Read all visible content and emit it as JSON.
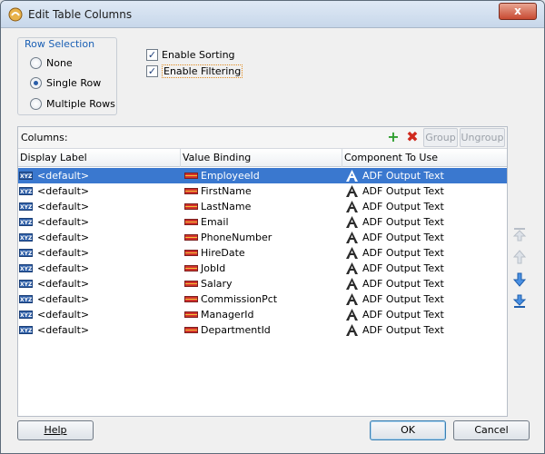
{
  "window": {
    "title": "Edit Table Columns",
    "close_label": "x"
  },
  "row_selection": {
    "legend": "Row Selection",
    "options": [
      {
        "label": "None",
        "checked": false
      },
      {
        "label": "Single Row",
        "checked": true
      },
      {
        "label": "Multiple Rows",
        "checked": false
      }
    ]
  },
  "options": {
    "enable_sorting": {
      "label": "Enable Sorting",
      "checked": true
    },
    "enable_filtering": {
      "label": "Enable Filtering",
      "checked": true
    }
  },
  "columns": {
    "label": "Columns:",
    "toolbar": {
      "add_label": "+",
      "delete_label": "✖",
      "group_label": "Group",
      "ungroup_label": "Ungroup"
    },
    "headers": [
      "Display Label",
      "Value Binding",
      "Component To Use"
    ],
    "rows": [
      {
        "display_label": "<default>",
        "value_binding": "EmployeeId",
        "component": "ADF Output Text",
        "selected": true
      },
      {
        "display_label": "<default>",
        "value_binding": "FirstName",
        "component": "ADF Output Text",
        "selected": false
      },
      {
        "display_label": "<default>",
        "value_binding": "LastName",
        "component": "ADF Output Text",
        "selected": false
      },
      {
        "display_label": "<default>",
        "value_binding": "Email",
        "component": "ADF Output Text",
        "selected": false
      },
      {
        "display_label": "<default>",
        "value_binding": "PhoneNumber",
        "component": "ADF Output Text",
        "selected": false
      },
      {
        "display_label": "<default>",
        "value_binding": "HireDate",
        "component": "ADF Output Text",
        "selected": false
      },
      {
        "display_label": "<default>",
        "value_binding": "JobId",
        "component": "ADF Output Text",
        "selected": false
      },
      {
        "display_label": "<default>",
        "value_binding": "Salary",
        "component": "ADF Output Text",
        "selected": false
      },
      {
        "display_label": "<default>",
        "value_binding": "CommissionPct",
        "component": "ADF Output Text",
        "selected": false
      },
      {
        "display_label": "<default>",
        "value_binding": "ManagerId",
        "component": "ADF Output Text",
        "selected": false
      },
      {
        "display_label": "<default>",
        "value_binding": "DepartmentId",
        "component": "ADF Output Text",
        "selected": false
      }
    ]
  },
  "icons": {
    "row_type_icon": "xyz-icon",
    "binding_icon": "binding-icon",
    "component_icon": "adf-output-text-icon",
    "reorder": [
      "move-to-top-icon",
      "move-up-icon",
      "move-down-icon",
      "move-to-bottom-icon"
    ]
  },
  "buttons": {
    "help": "Help",
    "ok": "OK",
    "cancel": "Cancel"
  },
  "colors": {
    "selected_row": "#3a78cf",
    "accent_legend": "#1a5fb4",
    "add_icon": "#2f9e2f",
    "delete_icon": "#d02a1e",
    "arrow_active": "#2d73c8",
    "arrow_disabled": "#b8bfc8"
  }
}
